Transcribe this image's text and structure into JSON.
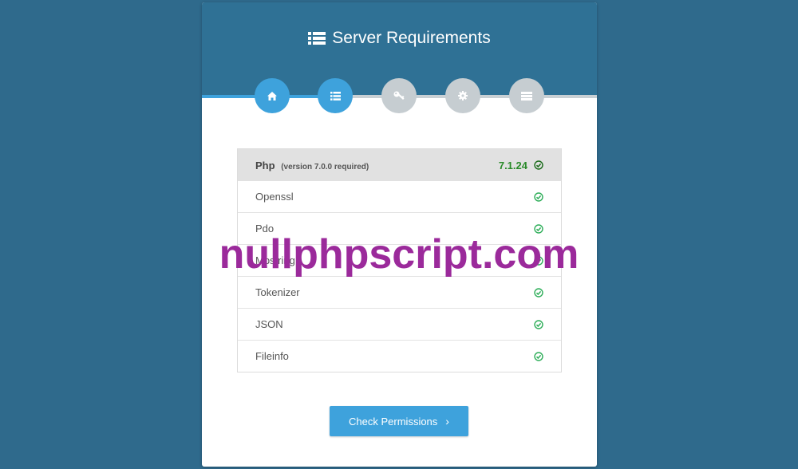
{
  "header": {
    "title": "Server Requirements",
    "title_icon": "list-icon"
  },
  "steps": [
    {
      "icon": "home-icon",
      "active": true
    },
    {
      "icon": "list-icon",
      "active": true
    },
    {
      "icon": "key-icon",
      "active": false
    },
    {
      "icon": "gear-icon",
      "active": false
    },
    {
      "icon": "server-icon",
      "active": false
    }
  ],
  "php": {
    "name": "Php",
    "note": "(version 7.0.0 required)",
    "version": "7.1.24"
  },
  "requirements": [
    {
      "name": "Openssl",
      "status": "ok"
    },
    {
      "name": "Pdo",
      "status": "ok"
    },
    {
      "name": "Mbstring",
      "status": "ok"
    },
    {
      "name": "Tokenizer",
      "status": "ok"
    },
    {
      "name": "JSON",
      "status": "ok"
    },
    {
      "name": "Fileinfo",
      "status": "ok"
    }
  ],
  "button": {
    "label": "Check Permissions",
    "icon": "chevron-right-icon"
  },
  "watermark": "nullphpscript.com",
  "colors": {
    "header_bg": "#2f7195",
    "accent": "#3ea2dc",
    "ok": "#2a8a2a",
    "page_bg": "#2f6a8c",
    "watermark": "#9b2a9b"
  }
}
